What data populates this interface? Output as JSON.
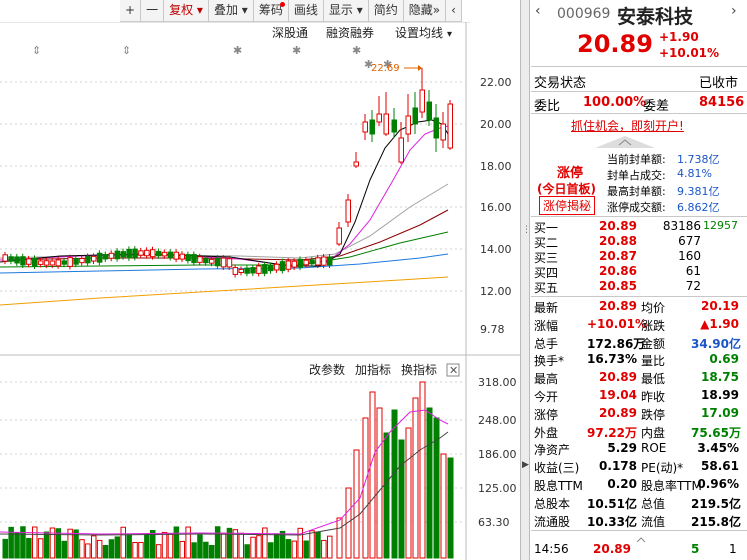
{
  "toolbar": {
    "plus": "+",
    "minus": "一",
    "fq": "复权",
    "overlay": "叠加",
    "chips": "筹码",
    "draw": "画线",
    "display": "显示",
    "brief": "简约",
    "hide": "隐藏"
  },
  "chart_menu": {
    "sgt": "深股通",
    "margin": "融资融券",
    "ma_settings": "设置均线",
    "change_param": "改参数",
    "add_indicator": "加指标",
    "swap_indicator": "换指标"
  },
  "price_axis": [
    "22.00",
    "20.00",
    "18.00",
    "16.00",
    "14.00",
    "12.00",
    "9.78"
  ],
  "volume_axis": [
    "318.00",
    "248.00",
    "186.00",
    "125.00",
    "63.30"
  ],
  "high_marker": "22.69",
  "stock": {
    "code": "000969",
    "name": "安泰科技",
    "price": "20.89",
    "change": "+1.90",
    "change_pct": "+10.01%"
  },
  "status": {
    "label": "交易状态",
    "value": "已收市",
    "wb_label": "委比",
    "wb_value": "100.00%",
    "wc_label": "委差",
    "wc_value": "84156"
  },
  "promo": "抓住机会，即刻开户!",
  "limit_up": {
    "title": "涨停",
    "sub": "(今日首板)",
    "btn": "涨停揭秘",
    "rows": [
      {
        "label": "当前封单额:",
        "value": "1.738亿"
      },
      {
        "label": "封单占成交:",
        "value": "4.81%"
      },
      {
        "label": "最高封单额:",
        "value": "9.381亿"
      },
      {
        "label": "涨停成交额:",
        "value": "6.862亿"
      }
    ]
  },
  "order_book": [
    {
      "label": "买一",
      "price": "20.89",
      "vol": "83186",
      "extra": "12957"
    },
    {
      "label": "买二",
      "price": "20.88",
      "vol": "677",
      "extra": ""
    },
    {
      "label": "买三",
      "price": "20.87",
      "vol": "160",
      "extra": ""
    },
    {
      "label": "买四",
      "price": "20.86",
      "vol": "61",
      "extra": ""
    },
    {
      "label": "买五",
      "price": "20.85",
      "vol": "72",
      "extra": ""
    }
  ],
  "stats": [
    {
      "l1": "最新",
      "v1": "20.89",
      "c1": "red",
      "l2": "均价",
      "v2": "20.19",
      "c2": "red"
    },
    {
      "l1": "涨幅",
      "v1": "+10.01%",
      "c1": "red",
      "l2": "涨跌",
      "v2": "▲1.90",
      "c2": "red"
    },
    {
      "l1": "总手",
      "v1": "172.86万",
      "c1": "black",
      "l2": "金额",
      "v2": "34.90亿",
      "c2": "blue"
    },
    {
      "l1": "换手*",
      "v1": "16.73%",
      "c1": "black",
      "l2": "量比",
      "v2": "0.69",
      "c2": "green"
    },
    {
      "l1": "最高",
      "v1": "20.89",
      "c1": "red",
      "l2": "最低",
      "v2": "18.75",
      "c2": "green"
    },
    {
      "l1": "今开",
      "v1": "19.04",
      "c1": "red",
      "l2": "昨收",
      "v2": "18.99",
      "c2": "black"
    },
    {
      "l1": "涨停",
      "v1": "20.89",
      "c1": "red",
      "l2": "跌停",
      "v2": "17.09",
      "c2": "green"
    },
    {
      "l1": "外盘",
      "v1": "97.22万",
      "c1": "red",
      "l2": "内盘",
      "v2": "75.65万",
      "c2": "green"
    },
    {
      "l1": "净资产",
      "v1": "5.29",
      "c1": "black",
      "l2": "ROE",
      "v2": "3.45%",
      "c2": "black"
    },
    {
      "l1": "收益(三)",
      "v1": "0.178",
      "c1": "black",
      "l2": "PE(动)*",
      "v2": "58.61",
      "c2": "black"
    },
    {
      "l1": "股息TTM",
      "v1": "0.20",
      "c1": "black",
      "l2": "股息率TTM",
      "v2": "0.96%",
      "c2": "black"
    },
    {
      "l1": "总股本",
      "v1": "10.51亿",
      "c1": "black",
      "l2": "总值",
      "v2": "219.5亿",
      "c2": "black"
    },
    {
      "l1": "流通股",
      "v1": "10.33亿",
      "c1": "black",
      "l2": "流值",
      "v2": "215.8亿",
      "c2": "black"
    }
  ],
  "tick": {
    "time": "14:56",
    "price": "20.89",
    "vol": "5",
    "num": "1"
  },
  "colors": {
    "up": "#e00000",
    "down": "#008000",
    "blue": "#1a56c8",
    "ma5": "#000000",
    "ma10": "#e020e0",
    "ma20": "#a0a0a0",
    "ma30": "#8b0000",
    "ma60": "#008000",
    "ma120": "#1e78dc",
    "ma250": "#f0a000"
  }
}
